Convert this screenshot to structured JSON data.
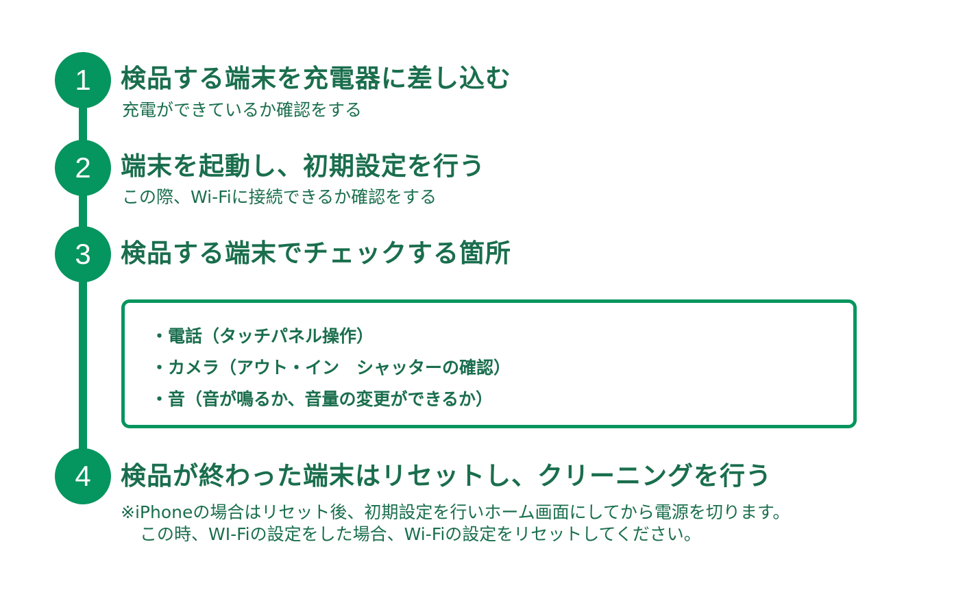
{
  "steps": [
    {
      "number": "1",
      "title": "検品する端末を充電器に差し込む",
      "subtitle": "充電ができているか確認をする"
    },
    {
      "number": "2",
      "title": "端末を起動し、初期設定を行う",
      "subtitle": "この際、Wi-Fiに接続できるか確認をする"
    },
    {
      "number": "3",
      "title": "検品する端末でチェックする箇所",
      "checklist": [
        "・電話（タッチパネル操作）",
        "・カメラ（アウト・イン　シャッターの確認）",
        "・音（音が鳴るか、音量の変更ができるか）"
      ]
    },
    {
      "number": "4",
      "title": "検品が終わった端末はリセットし、クリーニングを行う",
      "note_line1": "※iPhoneの場合はリセット後、初期設定を行いホーム画面にしてから電源を切ります。",
      "note_line2": "この時、WI-Fiの設定をした場合、Wi-Fiの設定をリセットしてください。"
    }
  ],
  "colors": {
    "accent": "#05955f",
    "text": "#1a6e4d"
  }
}
